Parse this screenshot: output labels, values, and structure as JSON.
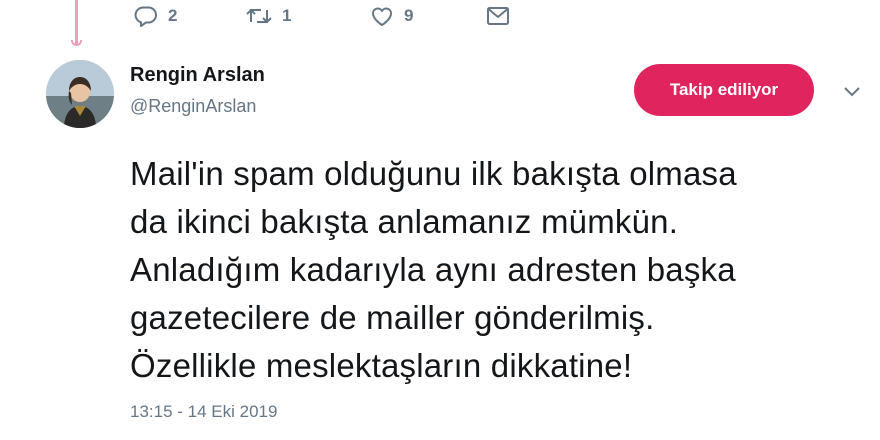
{
  "actions": {
    "reply_count": "2",
    "retweet_count": "1",
    "like_count": "9"
  },
  "author": {
    "name": "Rengin Arslan",
    "handle": "@RenginArslan"
  },
  "follow_button": {
    "label": "Takip ediliyor",
    "color": "#e0245e"
  },
  "tweet": {
    "text": "Mail'in spam olduğunu ilk bakışta olmasa\nda ikinci bakışta anlamanız mümkün.\nAnladığım kadarıyla aynı adresten başka\ngazetecilere de mailler gönderilmiş.\nÖzellikle meslektaşların dikkatine!",
    "timestamp": "13:15 - 14 Eki 2019"
  },
  "icons": [
    "reply-icon",
    "retweet-icon",
    "like-icon",
    "direct-message-icon",
    "chevron-down-icon"
  ],
  "colors": {
    "accent": "#e0245e",
    "muted_text": "#657786",
    "thread_line": "#e8a1b8"
  }
}
